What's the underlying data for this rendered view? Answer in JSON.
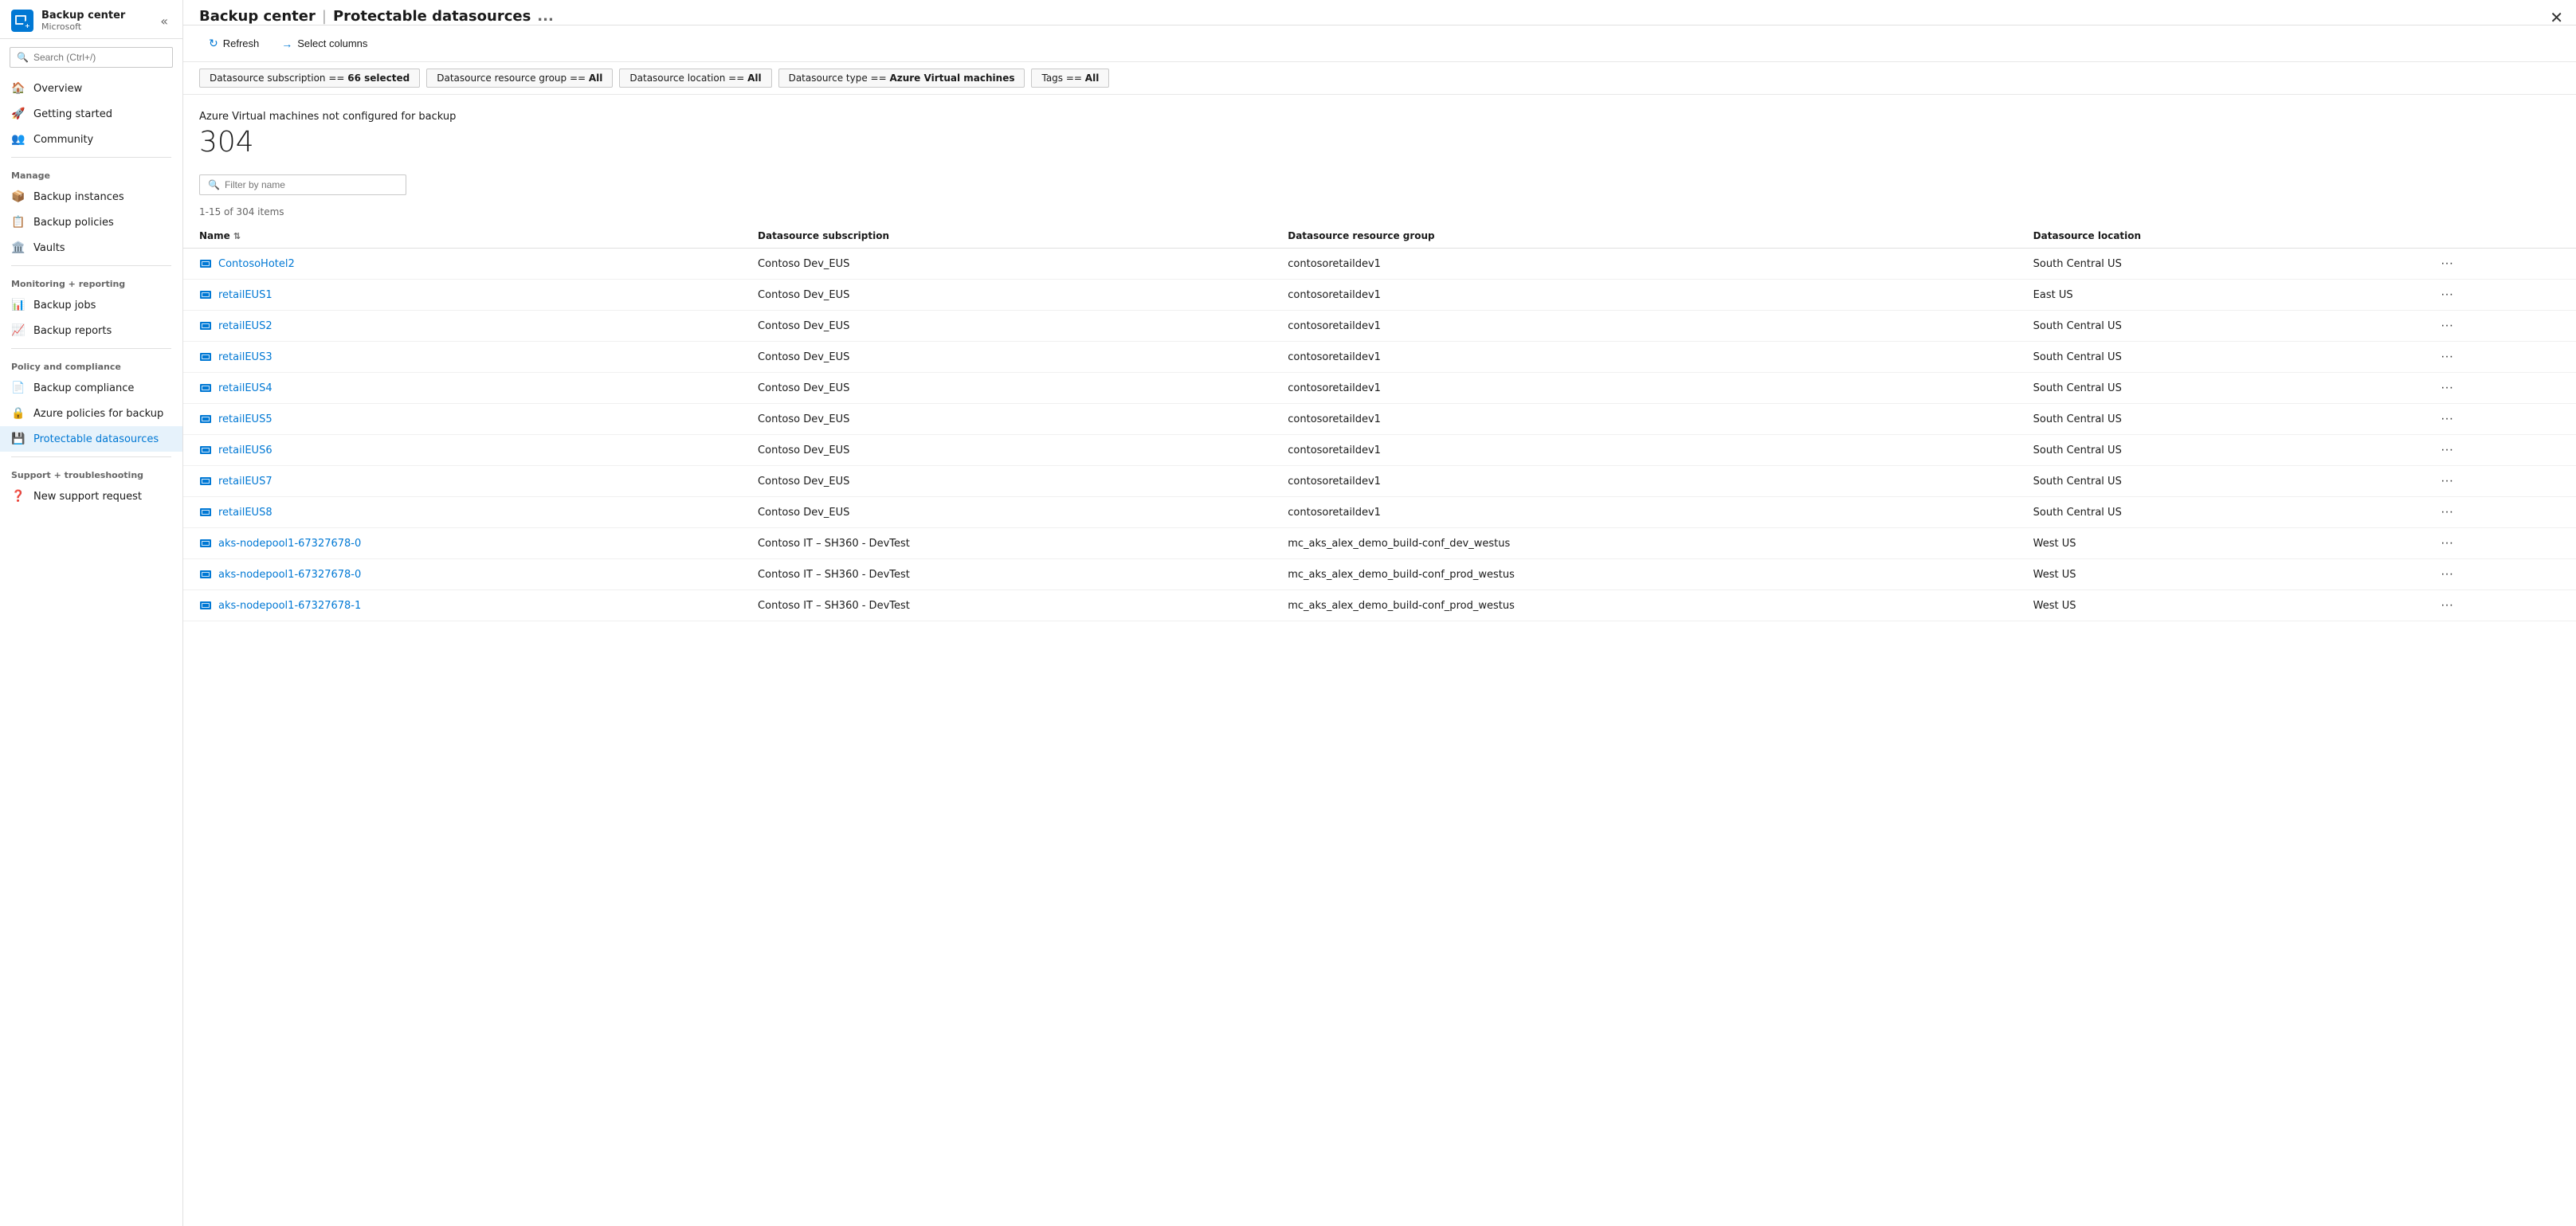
{
  "app": {
    "title": "Backup center",
    "subtitle": "Microsoft",
    "page_title": "Protectable datasources",
    "ellipsis_label": "...",
    "close_label": "✕"
  },
  "search": {
    "placeholder": "Search (Ctrl+/)"
  },
  "toolbar": {
    "refresh_label": "Refresh",
    "select_columns_label": "Select columns"
  },
  "filters": [
    {
      "id": "subscription",
      "text": "Datasource subscription == ",
      "bold": "66 selected"
    },
    {
      "id": "resource_group",
      "text": "Datasource resource group == ",
      "bold": "All"
    },
    {
      "id": "location",
      "text": "Datasource location == ",
      "bold": "All"
    },
    {
      "id": "type",
      "text": "Datasource type == ",
      "bold": "Azure Virtual machines"
    },
    {
      "id": "tags",
      "text": "Tags == ",
      "bold": "All"
    }
  ],
  "summary": {
    "label": "Azure Virtual machines not configured for backup",
    "count": "304"
  },
  "filter_input": {
    "placeholder": "Filter by name"
  },
  "items_range": "1-15 of 304 items",
  "table": {
    "columns": [
      {
        "id": "name",
        "label": "Name",
        "sortable": true
      },
      {
        "id": "subscription",
        "label": "Datasource subscription",
        "sortable": false
      },
      {
        "id": "resource_group",
        "label": "Datasource resource group",
        "sortable": false
      },
      {
        "id": "location",
        "label": "Datasource location",
        "sortable": false
      }
    ],
    "rows": [
      {
        "name": "ContosoHotel2",
        "subscription": "Contoso Dev_EUS",
        "resource_group": "contosoretaildev1",
        "location": "South Central US"
      },
      {
        "name": "retailEUS1",
        "subscription": "Contoso Dev_EUS",
        "resource_group": "contosoretaildev1",
        "location": "East US"
      },
      {
        "name": "retailEUS2",
        "subscription": "Contoso Dev_EUS",
        "resource_group": "contosoretaildev1",
        "location": "South Central US"
      },
      {
        "name": "retailEUS3",
        "subscription": "Contoso Dev_EUS",
        "resource_group": "contosoretaildev1",
        "location": "South Central US"
      },
      {
        "name": "retailEUS4",
        "subscription": "Contoso Dev_EUS",
        "resource_group": "contosoretaildev1",
        "location": "South Central US"
      },
      {
        "name": "retailEUS5",
        "subscription": "Contoso Dev_EUS",
        "resource_group": "contosoretaildev1",
        "location": "South Central US"
      },
      {
        "name": "retailEUS6",
        "subscription": "Contoso Dev_EUS",
        "resource_group": "contosoretaildev1",
        "location": "South Central US"
      },
      {
        "name": "retailEUS7",
        "subscription": "Contoso Dev_EUS",
        "resource_group": "contosoretaildev1",
        "location": "South Central US"
      },
      {
        "name": "retailEUS8",
        "subscription": "Contoso Dev_EUS",
        "resource_group": "contosoretaildev1",
        "location": "South Central US"
      },
      {
        "name": "aks-nodepool1-67327678-0",
        "subscription": "Contoso IT – SH360 - DevTest",
        "resource_group": "mc_aks_alex_demo_build-conf_dev_westus",
        "location": "West US"
      },
      {
        "name": "aks-nodepool1-67327678-0",
        "subscription": "Contoso IT – SH360 - DevTest",
        "resource_group": "mc_aks_alex_demo_build-conf_prod_westus",
        "location": "West US"
      },
      {
        "name": "aks-nodepool1-67327678-1",
        "subscription": "Contoso IT – SH360 - DevTest",
        "resource_group": "mc_aks_alex_demo_build-conf_prod_westus",
        "location": "West US"
      }
    ]
  },
  "nav": {
    "items_top": [
      {
        "id": "overview",
        "label": "Overview",
        "icon": "🏠"
      },
      {
        "id": "getting-started",
        "label": "Getting started",
        "icon": "🚀"
      },
      {
        "id": "community",
        "label": "Community",
        "icon": "👥"
      }
    ],
    "sections": [
      {
        "label": "Manage",
        "items": [
          {
            "id": "backup-instances",
            "label": "Backup instances",
            "icon": "📦"
          },
          {
            "id": "backup-policies",
            "label": "Backup policies",
            "icon": "📋"
          },
          {
            "id": "vaults",
            "label": "Vaults",
            "icon": "🏛️"
          }
        ]
      },
      {
        "label": "Monitoring + reporting",
        "items": [
          {
            "id": "backup-jobs",
            "label": "Backup jobs",
            "icon": "📊"
          },
          {
            "id": "backup-reports",
            "label": "Backup reports",
            "icon": "📈"
          }
        ]
      },
      {
        "label": "Policy and compliance",
        "items": [
          {
            "id": "backup-compliance",
            "label": "Backup compliance",
            "icon": "📄"
          },
          {
            "id": "azure-policies",
            "label": "Azure policies for backup",
            "icon": "🔒"
          },
          {
            "id": "protectable-datasources",
            "label": "Protectable datasources",
            "icon": "💾",
            "active": true
          }
        ]
      },
      {
        "label": "Support + troubleshooting",
        "items": [
          {
            "id": "new-support-request",
            "label": "New support request",
            "icon": "❓"
          }
        ]
      }
    ]
  }
}
